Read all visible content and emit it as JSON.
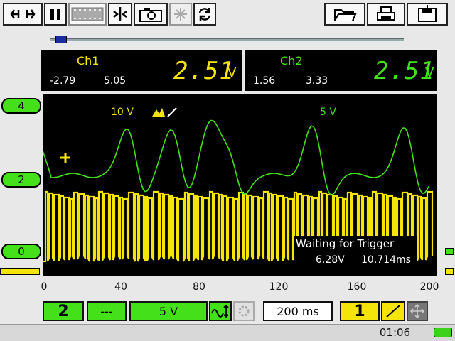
{
  "toolbar": {
    "left_icons": [
      "link-icon",
      "pause-icon",
      "filmstrip-icon",
      "split-view-icon",
      "camera-icon",
      "sparkle-icon",
      "refresh-icon"
    ],
    "right_icons": [
      "folder-icon",
      "printer-icon",
      "save-icon"
    ]
  },
  "ch1": {
    "label": "Ch1",
    "min": "-2.79",
    "max": "5.05",
    "value": "2.51",
    "unit": "V",
    "color": "#f5e40a"
  },
  "ch2": {
    "label": "Ch2",
    "min": "1.56",
    "max": "3.33",
    "value": "2.51",
    "unit": "V",
    "color": "#44e01a"
  },
  "screen": {
    "ch1_scale": "10 V",
    "ch2_scale": "5 V",
    "status": "Waiting for Trigger",
    "trigger_level": "6.28V",
    "trigger_time": "10.714ms"
  },
  "levels": [
    "4",
    "2",
    "0"
  ],
  "axis_ticks": [
    "0",
    "40",
    "80",
    "120",
    "160",
    "200"
  ],
  "controls": {
    "channel": "2",
    "coupling": "---",
    "volts_div": "5 V",
    "timebase": "200 ms",
    "trigger_channel": "1"
  },
  "status": {
    "time": "01:06"
  }
}
